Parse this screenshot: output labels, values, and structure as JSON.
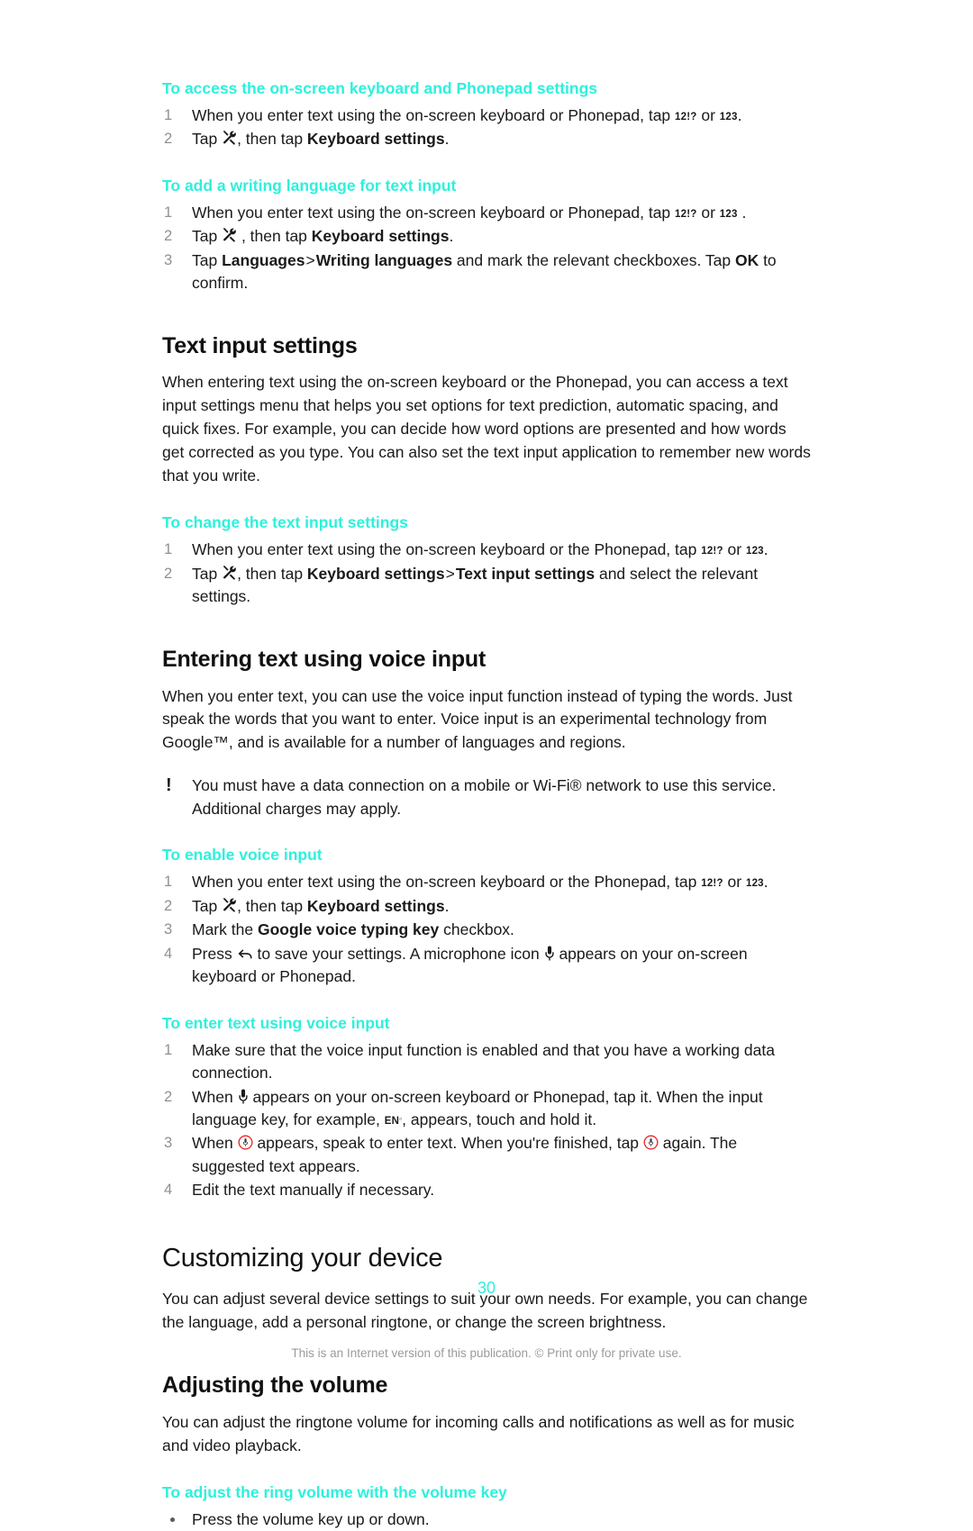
{
  "colors": {
    "accent": "#2ff0dc",
    "text": "#1a1a1a",
    "step_number": "#909090",
    "footer": "#9b9b9b"
  },
  "sections": {
    "task_access_keyboard": {
      "heading": "To access the on-screen keyboard and Phonepad settings",
      "steps": [
        {
          "num": "1",
          "prefix": "When you enter text using the on-screen keyboard or Phonepad, tap ",
          "key1": "12!?",
          "mid": " or ",
          "key2": "123",
          "suffix": "."
        },
        {
          "num": "2",
          "prefix": "Tap ",
          "icon": "wrench-icon",
          "mid": ", then tap ",
          "bold": "Keyboard settings",
          "suffix": "."
        }
      ]
    },
    "task_add_language": {
      "heading": "To add a writing language for text input",
      "steps": [
        {
          "num": "1",
          "prefix": "When you enter text using the on-screen keyboard or Phonepad, tap ",
          "key1": "12!?",
          "mid": " or ",
          "key2": "123",
          "suffix": " ."
        },
        {
          "num": "2",
          "prefix": "Tap ",
          "icon": "wrench-icon",
          "mid": " , then tap ",
          "bold": "Keyboard settings",
          "suffix": "."
        },
        {
          "num": "3",
          "prefix": "Tap ",
          "bold1": "Languages",
          "gt": ">",
          "bold2": "Writing languages",
          "mid": " and mark the relevant checkboxes. Tap ",
          "bold3": "OK",
          "suffix": " to confirm."
        }
      ]
    },
    "text_input_settings": {
      "heading": "Text input settings",
      "body": "When entering text using the on-screen keyboard or the Phonepad, you can access a text input settings menu that helps you set options for text prediction, automatic spacing, and quick fixes. For example, you can decide how word options are presented and how words get corrected as you type. You can also set the text input application to remember new words that you write."
    },
    "task_change_text_input": {
      "heading": "To change the text input settings",
      "steps": [
        {
          "num": "1",
          "prefix": "When you enter text using the on-screen keyboard or the Phonepad, tap ",
          "key1": "12!?",
          "mid": " or ",
          "key2": "123",
          "suffix": "."
        },
        {
          "num": "2",
          "prefix": "Tap ",
          "icon": "wrench-icon",
          "mid": ", then tap ",
          "bold1": "Keyboard settings",
          "gt": ">",
          "bold2": "Text input settings",
          "suffix": " and select the relevant settings."
        }
      ]
    },
    "voice_input": {
      "heading": "Entering text using voice input",
      "body": "When you enter text, you can use the voice input function instead of typing the words. Just speak the words that you want to enter. Voice input is an experimental technology from Google™, and is available for a number of languages and regions.",
      "note": "You must have a data connection on a mobile or Wi-Fi® network to use this service. Additional charges may apply."
    },
    "task_enable_voice": {
      "heading": "To enable voice input",
      "steps": [
        {
          "num": "1",
          "prefix": "When you enter text using the on-screen keyboard or the Phonepad, tap ",
          "key1": "12!?",
          "mid": " or ",
          "key2": "123",
          "suffix": "."
        },
        {
          "num": "2",
          "prefix": "Tap ",
          "icon": "wrench-icon",
          "mid": ", then tap ",
          "bold": "Keyboard settings",
          "suffix": "."
        },
        {
          "num": "3",
          "prefix": "Mark the ",
          "bold": "Google voice typing key",
          "suffix": " checkbox."
        },
        {
          "num": "4",
          "prefix": "Press ",
          "icon": "back-arrow-icon",
          "mid": " to save your settings. A microphone icon ",
          "icon2": "microphone-icon",
          "suffix": " appears on your on-screen keyboard or Phonepad."
        }
      ]
    },
    "task_enter_voice": {
      "heading": "To enter text using voice input",
      "steps": [
        {
          "num": "1",
          "text": "Make sure that the voice input function is enabled and that you have a working data connection."
        },
        {
          "num": "2",
          "prefix": "When ",
          "icon": "microphone-icon",
          "mid": " appears on your on-screen keyboard or Phonepad, tap it. When the input language key, for example, ",
          "key": "EN",
          "suffix": ", appears, touch and hold it."
        },
        {
          "num": "3",
          "prefix": "When ",
          "icon": "microphone-record-icon",
          "mid": " appears, speak to enter text. When you're finished, tap ",
          "icon2": "microphone-record-icon",
          "suffix": " again. The suggested text appears."
        },
        {
          "num": "4",
          "text": "Edit the text manually if necessary."
        }
      ]
    },
    "customizing": {
      "heading": "Customizing your device",
      "body": "You can adjust several device settings to suit your own needs. For example, you can change the language, add a personal ringtone, or change the screen brightness."
    },
    "adjusting_volume": {
      "heading": "Adjusting the volume",
      "body": "You can adjust the ringtone volume for incoming calls and notifications as well as for music and video playback."
    },
    "task_ring_volume": {
      "heading": "To adjust the ring volume with the volume key",
      "bullets": [
        {
          "text": "Press the volume key up or down."
        }
      ]
    }
  },
  "footer": {
    "page_number": "30",
    "disclaimer": "This is an Internet version of this publication. © Print only for private use."
  }
}
